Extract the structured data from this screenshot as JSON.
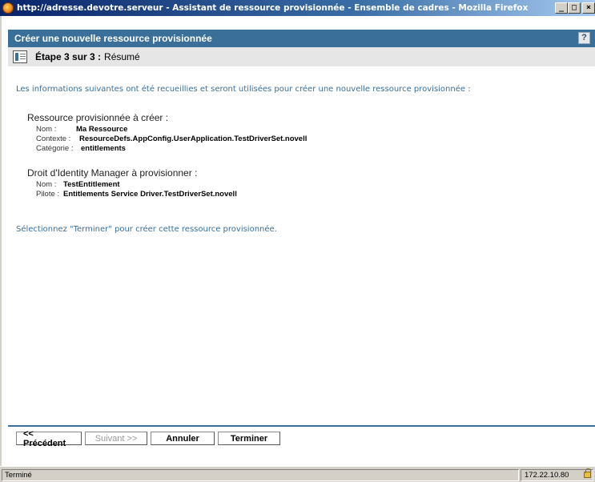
{
  "window": {
    "title": "http://adresse.devotre.serveur - Assistant de ressource provisionnée - Ensemble de cadres - Mozilla Firefox",
    "minimize": "_",
    "maximize": "□",
    "close": "×"
  },
  "header": {
    "title": "Créer une nouvelle ressource provisionnée",
    "help": "?"
  },
  "step": {
    "prefix": "Étape 3 sur 3 :",
    "label": "Résumé"
  },
  "intro_text": "Les informations suivantes ont été recueillies et seront utilisées pour créer une nouvelle ressource provisionnée :",
  "resource": {
    "title": "Ressource provisionnée à créer :",
    "fields": [
      {
        "key": "Nom :",
        "value": "Ma Ressource"
      },
      {
        "key": "Contexte :",
        "value": "ResourceDefs.AppConfig.UserApplication.TestDriverSet.novell"
      },
      {
        "key": "Catégorie :",
        "value": "entitlements"
      }
    ]
  },
  "entitlement": {
    "title": "Droit d'Identity Manager à provisionner :",
    "fields": [
      {
        "key": "Nom :",
        "value": "TestEntitlement"
      },
      {
        "key": "Pilote :",
        "value": "Entitlements Service Driver.TestDriverSet.novell"
      }
    ]
  },
  "finish_text": "Sélectionnez \"Terminer\" pour créer cette ressource provisionnée.",
  "buttons": {
    "previous": "<< Précédent",
    "next": "Suivant >>",
    "cancel": "Annuler",
    "finish": "Terminer"
  },
  "status": {
    "text": "Terminé",
    "ip": "172.22.10.80"
  },
  "icons": {
    "browser": "firefox-icon",
    "step": "wizard-step-icon",
    "status": "lock-icon"
  }
}
